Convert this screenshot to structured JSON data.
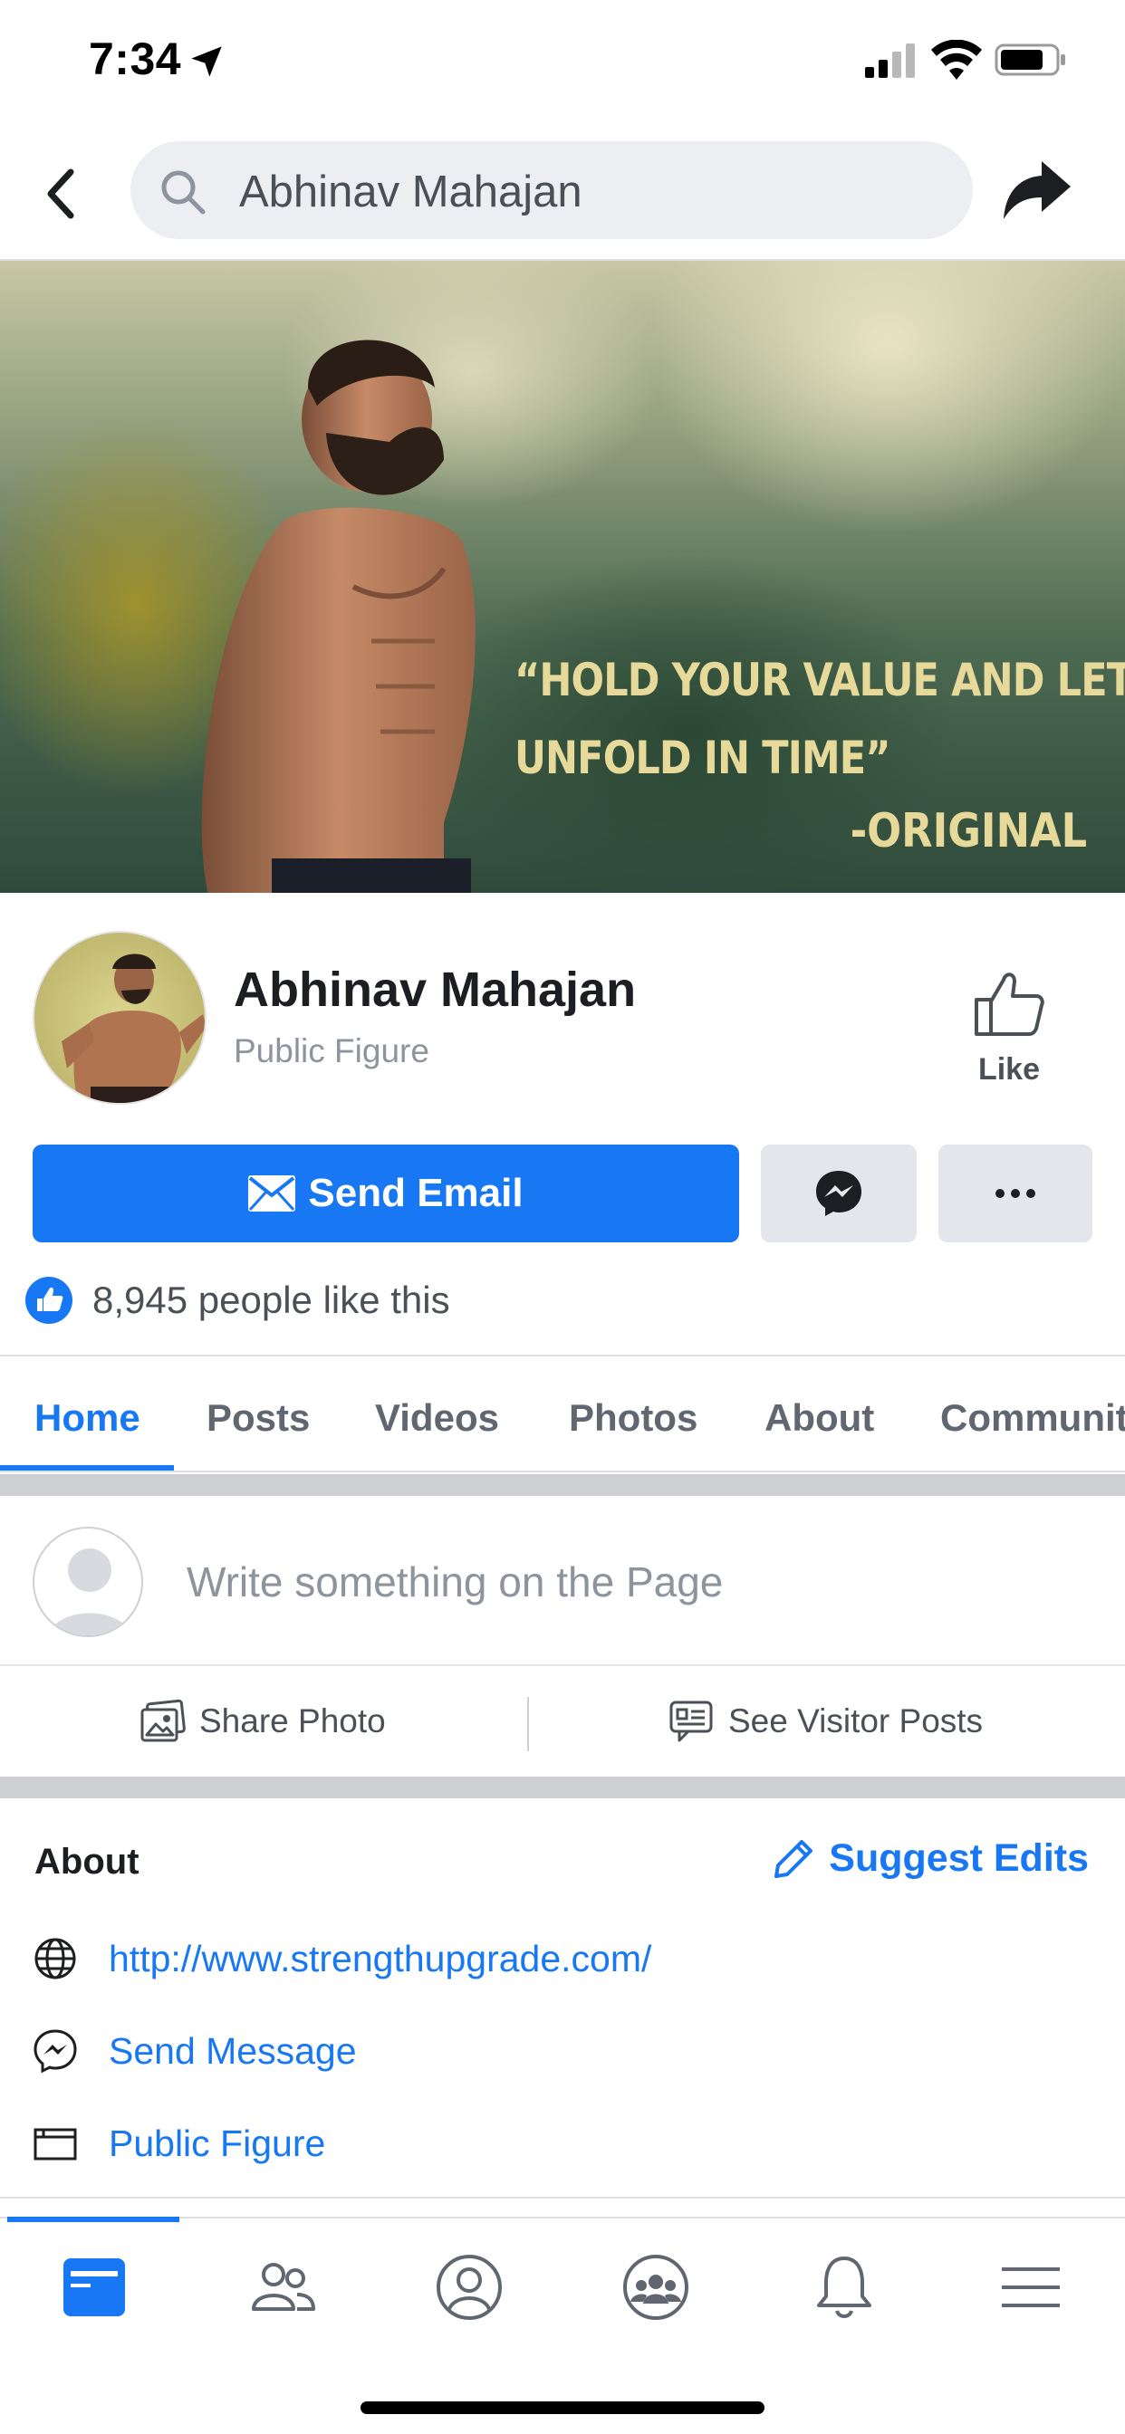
{
  "status_bar": {
    "time": "7:34",
    "icons": [
      "location-arrow-icon",
      "cellular-signal-icon",
      "wifi-icon",
      "battery-icon"
    ]
  },
  "top_nav": {
    "back_icon": "chevron-left-icon",
    "search_icon": "search-icon",
    "search_value": "Abhinav Mahajan",
    "share_icon": "share-arrow-icon"
  },
  "cover": {
    "quote_line1": "“HOLD YOUR VALUE AND LET IT",
    "quote_line2": "UNFOLD IN TIME”",
    "attribution": "-ORIGINAL"
  },
  "profile": {
    "name": "Abhinav Mahajan",
    "category": "Public Figure",
    "like_label": "Like",
    "send_email_label": "Send Email",
    "likes_count_text": "8,945 people like this"
  },
  "tabs": [
    {
      "label": "Home",
      "active": true
    },
    {
      "label": "Posts",
      "active": false
    },
    {
      "label": "Videos",
      "active": false
    },
    {
      "label": "Photos",
      "active": false
    },
    {
      "label": "About",
      "active": false
    },
    {
      "label": "Communit",
      "active": false
    }
  ],
  "composer": {
    "placeholder": "Write something on the Page",
    "share_photo_label": "Share Photo",
    "see_visitor_posts_label": "See Visitor Posts"
  },
  "about": {
    "title": "About",
    "suggest_edits_label": "Suggest Edits",
    "website": "http://www.strengthupgrade.com/",
    "send_message": "Send Message",
    "category_link": "Public Figure"
  },
  "bottom_nav": {
    "items": [
      "news-feed-icon",
      "friends-icon",
      "profile-icon",
      "groups-icon",
      "notifications-bell-icon",
      "menu-icon"
    ],
    "active_index": 0
  },
  "colors": {
    "accent": "#1877f2",
    "button_gray": "#e4e6eb",
    "secondary_text": "#8d949e",
    "quote_text": "#e7d99a"
  }
}
